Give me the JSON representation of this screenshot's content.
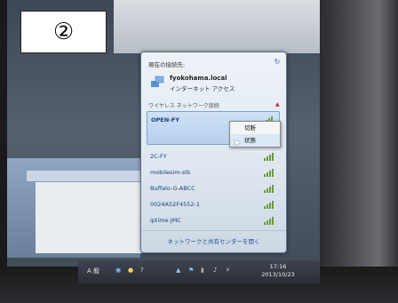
{
  "label": "②",
  "flyout": {
    "current_connection_header": "現在の接続先:",
    "connection_name": "fyokohama.local",
    "connection_type": "インターネット アクセス",
    "section_title": "ワイヤレス ネットワーク接続",
    "networks": [
      {
        "name": "OPEN-FY",
        "selected": true
      },
      {
        "name": "2C-FY",
        "selected": false
      },
      {
        "name": "mobilesim-stk",
        "selected": false
      },
      {
        "name": "Buffalo-G-ABCC",
        "selected": false
      },
      {
        "name": "0024A52F4552-1",
        "selected": false
      },
      {
        "name": "iptime JMC",
        "selected": false
      }
    ],
    "footer_link": "ネットワークと共有センターを開く"
  },
  "context_menu": {
    "items": [
      "切断",
      "状態"
    ]
  },
  "taskbar": {
    "ime_label": "A 般",
    "clock_time": "17:16",
    "clock_date": "2013/10/23"
  },
  "colors": {
    "link": "#1f3f7a",
    "signal": "#6c9a3c",
    "selected_bg": "#b7cfee"
  }
}
